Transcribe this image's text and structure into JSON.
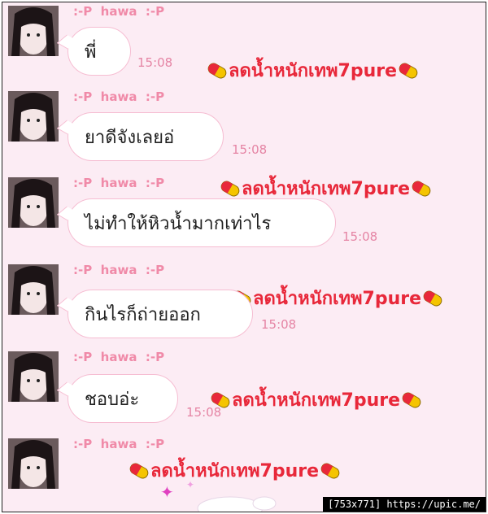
{
  "colors": {
    "background": "#fcecf4",
    "sender": "#f08aa8",
    "bubble_border": "#f6bdd2",
    "time": "#e584a4",
    "watermark": "#e8283a",
    "pill_left": "#e8283a",
    "pill_right": "#f5c400"
  },
  "chat": {
    "messages": [
      {
        "sender": ":-P  hawa  :-P",
        "text": "พี่",
        "time": "15:08",
        "watermark": "ลดน้ำหนักเทพ7pure"
      },
      {
        "sender": ":-P  hawa  :-P",
        "text": "ยาดีจังเลยอ่",
        "time": "15:08",
        "watermark": ""
      },
      {
        "sender": ":-P  hawa  :-P",
        "text": "ไม่ทำให้หิวน้ำมากเท่าไร",
        "time": "15:08",
        "watermark": "ลดน้ำหนักเทพ7pure"
      },
      {
        "sender": ":-P  hawa  :-P",
        "text": "กินไรก็ถ่ายออก",
        "time": "15:08",
        "watermark": "ลดน้ำหนักเทพ7pure"
      },
      {
        "sender": ":-P  hawa  :-P",
        "text": "ชอบอ่ะ",
        "time": "15:08",
        "watermark": "ลดน้ำหนักเทพ7pure"
      },
      {
        "sender": ":-P  hawa  :-P",
        "text": "",
        "time": "",
        "watermark": "ลดน้ำหนักเทพ7pure"
      }
    ]
  },
  "footer": {
    "label": "[753x771] https://upic.me/"
  },
  "icons": {
    "avatar": "user-photo",
    "pill": "capsule-emoji",
    "sparkle": "sparkle-star"
  }
}
